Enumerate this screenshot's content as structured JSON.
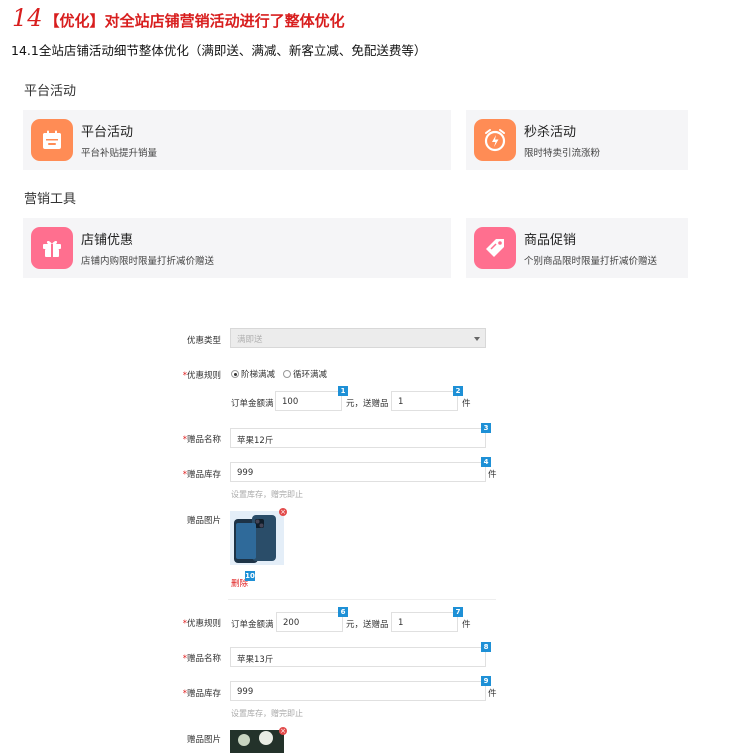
{
  "heading": {
    "number": "14",
    "tag": "【优化】",
    "text": "对全站店铺营销活动进行了整体优化",
    "subtitle": "14.1全站店铺活动细节整体优化（满即送、满减、新客立减、免配送费等）"
  },
  "sections": [
    {
      "label": "平台活动",
      "cards": [
        {
          "title": "平台活动",
          "desc": "平台补贴提升销量",
          "icon": "calendar-icon",
          "color": "#ff8c55"
        },
        {
          "title": "秒杀活动",
          "desc": "限时特卖引流涨粉",
          "icon": "alarm-clock-icon",
          "color": "#ff8c55"
        }
      ]
    },
    {
      "label": "营销工具",
      "cards": [
        {
          "title": "店铺优惠",
          "desc": "店铺内购限时限量打折减价赠送",
          "icon": "gift-icon",
          "color": "#ff6f8f"
        },
        {
          "title": "商品促销",
          "desc": "个别商品限时限量打折减价赠送",
          "icon": "tag-icon",
          "color": "#ff6f8f"
        }
      ]
    }
  ],
  "form": {
    "type_label": "优惠类型",
    "type_value": "满即送",
    "rule_label": "优惠规则",
    "radio_1": "阶梯满减",
    "radio_2": "循环满减",
    "order_amount_label": "订单金额满",
    "yuan_gift": "元，送赠品",
    "piece": "件",
    "gift_name_label": "赠品名称",
    "gift_stock_label": "赠品库存",
    "gift_image_label": "赠品图片",
    "stock_hint": "设置库存，赠完即止",
    "delete_label": "删除",
    "tier1": {
      "amount": "100",
      "gift_qty": "1",
      "gift_name": "苹果12斤",
      "stock": "999"
    },
    "tier2": {
      "amount": "200",
      "gift_qty": "1",
      "gift_name": "苹果13斤",
      "stock": "999"
    },
    "badges": [
      "1",
      "2",
      "3",
      "4",
      "10",
      "6",
      "7",
      "8",
      "9"
    ]
  }
}
